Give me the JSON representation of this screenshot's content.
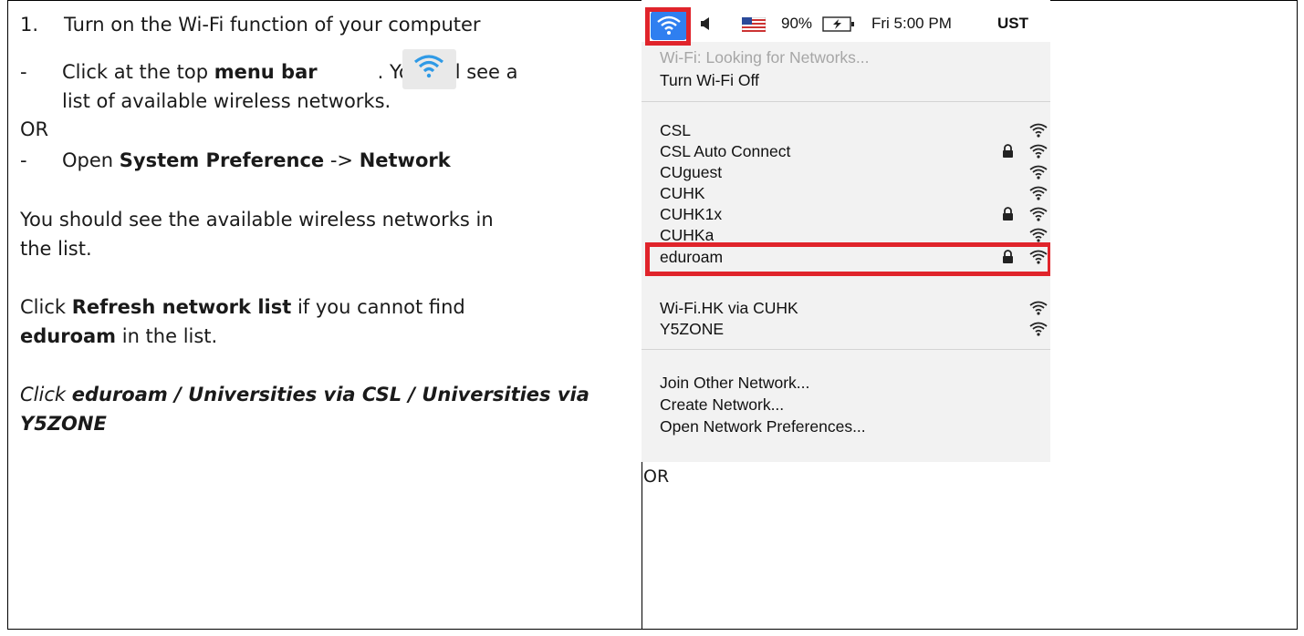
{
  "left": {
    "step": "1.",
    "title": "Turn on the Wi-Fi function of your computer",
    "b1_pre": "Click at the top ",
    "b1_bold": "menu bar",
    "b1_post": ". You will see a",
    "b1_line2": "list of available wireless networks.",
    "or1": "OR",
    "b2_pre": "Open ",
    "b2_bold1": "System Preference",
    "b2_mid": " -> ",
    "b2_bold2": "Network",
    "p1_line1": "You should see the available wireless networks in",
    "p1_line2": "the list.",
    "p2_pre": "Click ",
    "p2_bold": "Refresh network list",
    "p2_post": " if you cannot find",
    "p2_line2_bold": "eduroam",
    "p2_line2_post": " in the list.",
    "p3_pre": "Click ",
    "p3_bold": "eduroam / Universities via CSL / Universities via",
    "p3_line2": "Y5ZONE",
    "dash": "-"
  },
  "menubar": {
    "battery": "90%",
    "time": "Fri 5:00 PM",
    "user": "UST"
  },
  "menu": {
    "status": "Wi-Fi: Looking for Networks...",
    "turn_off": "Turn Wi-Fi Off",
    "networks": [
      {
        "name": "CSL",
        "locked": false
      },
      {
        "name": "CSL Auto Connect",
        "locked": true
      },
      {
        "name": "CUguest",
        "locked": false
      },
      {
        "name": "CUHK",
        "locked": false
      },
      {
        "name": "CUHK1x",
        "locked": true
      },
      {
        "name": "CUHKa",
        "locked": false
      },
      {
        "name": "eduroam",
        "locked": true
      },
      {
        "name": "Wi-Fi.HK via CUHK",
        "locked": false
      },
      {
        "name": "Y5ZONE",
        "locked": false
      }
    ],
    "join_other": "Join Other Network...",
    "create": "Create Network...",
    "open_prefs": "Open Network Preferences..."
  },
  "right_or": "OR",
  "colors": {
    "highlight": "#e0242b",
    "wifi_blue": "#2f7ff0"
  }
}
